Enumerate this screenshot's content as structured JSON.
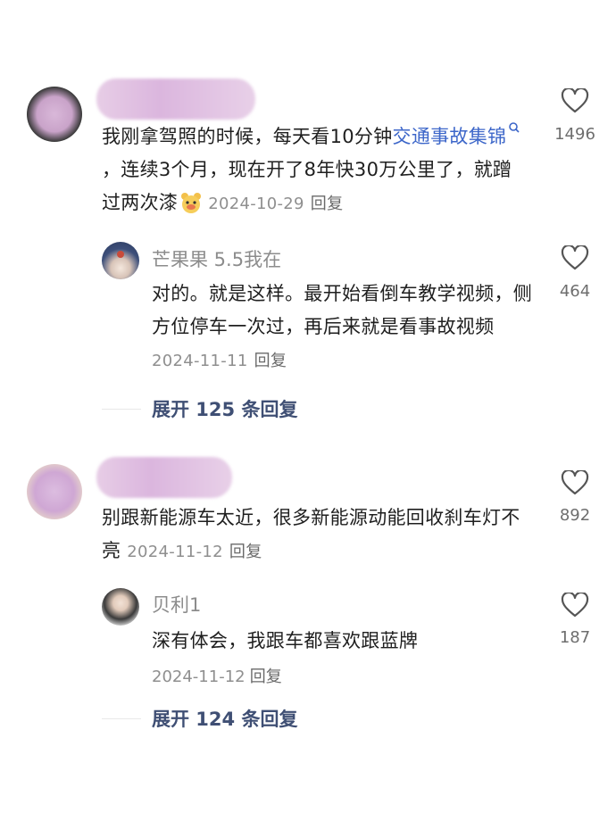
{
  "comments": [
    {
      "text": "我刚拿驾照的时候，每天看10分钟",
      "link_text": "交通事故集锦",
      "rest_text": "，连续3个月，现在开了8年快30万公里了，就蹭过两次漆",
      "date": "2024-10-29",
      "reply_label": "回复",
      "like_count": "1496",
      "reply": {
        "author": "芒果果 5.5我在",
        "text": "对的。就是这样。最开始看倒车教学视频，侧方位停车一次过，再后来就是看事故视频",
        "date": "2024-11-11",
        "reply_label": "回复",
        "like_count": "464"
      },
      "expand_label": "展开 125 条回复"
    },
    {
      "text": "别跟新能源车太近，很多新能源动能回收刹车灯不亮",
      "date": "2024-11-12",
      "reply_label": "回复",
      "like_count": "892",
      "reply": {
        "author": "贝利1",
        "text": "深有体会，我跟车都喜欢跟蓝牌",
        "date": "2024-11-12",
        "reply_label": "回复",
        "like_count": "187"
      },
      "expand_label": "展开 124 条回复"
    }
  ],
  "icons": {
    "like": "heart-outline-icon",
    "search": "search-magnifier-icon",
    "emoji": "bear-face-emoji-icon"
  }
}
